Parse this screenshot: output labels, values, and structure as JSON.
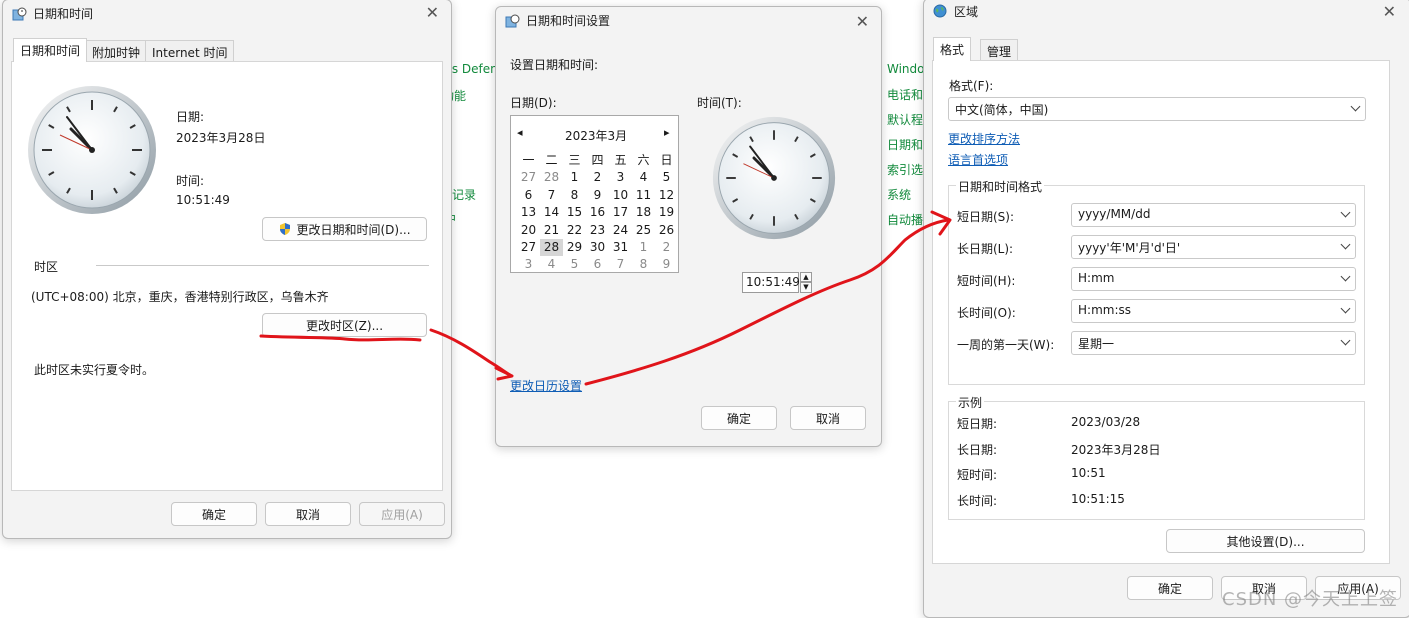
{
  "background_links": {
    "left": [
      "ws Defen",
      "功能",
      "",
      "",
      "选记录",
      "中"
    ],
    "right": [
      "Windo",
      "电话和",
      "默认程",
      "日期和",
      "索引选",
      "系统",
      "自动播"
    ]
  },
  "dt_window": {
    "title": "日期和时间",
    "tabs": [
      "日期和时间",
      "附加时钟",
      "Internet 时间"
    ],
    "date_label": "日期:",
    "date_value": "2023年3月28日",
    "time_label": "时间:",
    "time_value": "10:51:49",
    "change_datetime_button": "更改日期和时间(D)...",
    "timezone_section": "时区",
    "timezone_value": "(UTC+08:00) 北京，重庆，香港特别行政区，乌鲁木齐",
    "change_timezone_button": "更改时区(Z)...",
    "dst_note": "此时区未实行夏令时。",
    "ok": "确定",
    "cancel": "取消",
    "apply": "应用(A)"
  },
  "settings_window": {
    "title": "日期和时间设置",
    "heading": "设置日期和时间:",
    "date_label": "日期(D):",
    "time_label": "时间(T):",
    "month_label": "2023年3月",
    "prev_glyph": "◂",
    "next_glyph": "▸",
    "weekdays": [
      "一",
      "二",
      "三",
      "四",
      "五",
      "六",
      "日"
    ],
    "weeks": [
      [
        "27",
        "28",
        "1",
        "2",
        "3",
        "4",
        "5"
      ],
      [
        "6",
        "7",
        "8",
        "9",
        "10",
        "11",
        "12"
      ],
      [
        "13",
        "14",
        "15",
        "16",
        "17",
        "18",
        "19"
      ],
      [
        "20",
        "21",
        "22",
        "23",
        "24",
        "25",
        "26"
      ],
      [
        "27",
        "28",
        "29",
        "30",
        "31",
        "1",
        "2"
      ],
      [
        "3",
        "4",
        "5",
        "6",
        "7",
        "8",
        "9"
      ]
    ],
    "dim_cells": [
      "0-0",
      "0-1",
      "4-5",
      "4-6",
      "5-0",
      "5-1",
      "5-2",
      "5-3",
      "5-4",
      "5-5",
      "5-6"
    ],
    "selected_cell": "4-1",
    "time_input": "10:51:49",
    "change_calendar_link": "更改日历设置",
    "ok": "确定",
    "cancel": "取消"
  },
  "region_window": {
    "title": "区域",
    "tabs": [
      "格式",
      "管理"
    ],
    "format_label": "格式(F):",
    "format_value": "中文(简体，中国)",
    "sort_link": "更改排序方法",
    "lang_link": "语言首选项",
    "group_title": "日期和时间格式",
    "fields": [
      {
        "label": "短日期(S):",
        "value": "yyyy/MM/dd"
      },
      {
        "label": "长日期(L):",
        "value": "yyyy'年'M'月'd'日'"
      },
      {
        "label": "短时间(H):",
        "value": "H:mm"
      },
      {
        "label": "长时间(O):",
        "value": "H:mm:ss"
      },
      {
        "label": "一周的第一天(W):",
        "value": "星期一"
      }
    ],
    "example_title": "示例",
    "examples": [
      {
        "label": "短日期:",
        "value": "2023/03/28"
      },
      {
        "label": "长日期:",
        "value": "2023年3月28日"
      },
      {
        "label": "短时间:",
        "value": "10:51"
      },
      {
        "label": "长时间:",
        "value": "10:51:15"
      }
    ],
    "other_settings_button": "其他设置(D)...",
    "ok": "确定",
    "cancel": "取消",
    "apply": "应用(A)"
  },
  "watermark": "CSDN @今天上上签",
  "colors": {
    "annotation_red": "#e0141a",
    "link_blue": "#0f5db5",
    "bg_link_green": "#128a3c"
  }
}
